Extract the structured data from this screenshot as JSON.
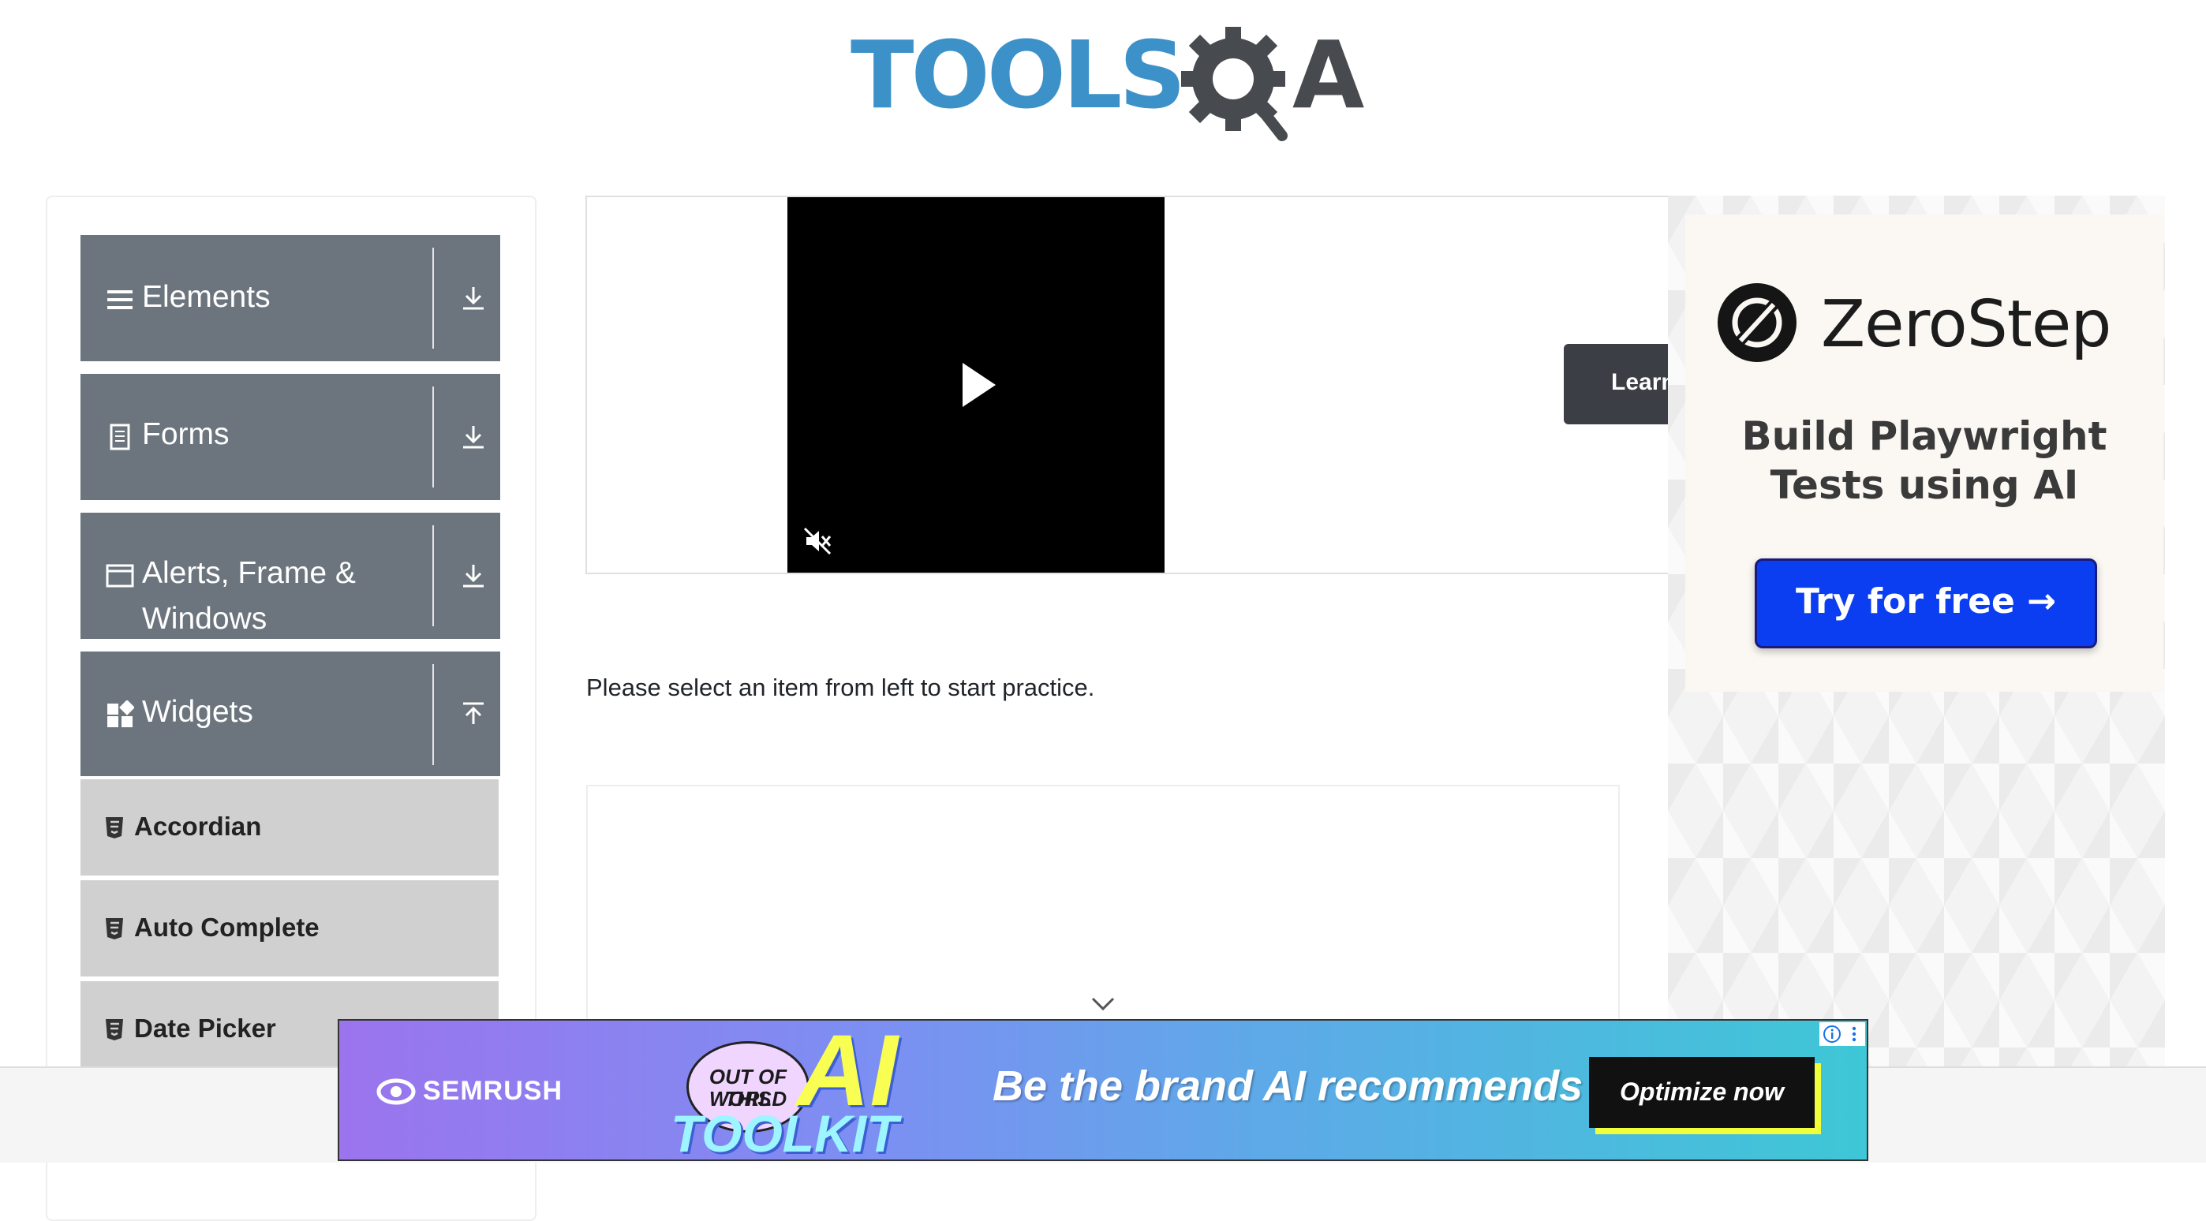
{
  "header": {
    "logo_text": "TOOLS",
    "logo_suffix": "A"
  },
  "sidebar": {
    "groups": [
      {
        "label": "Elements",
        "icon": "list-icon",
        "arrow": "download-arrow-icon"
      },
      {
        "label": "Forms",
        "icon": "document-icon",
        "arrow": "download-arrow-icon"
      },
      {
        "label_line1": "Alerts, Frame &",
        "label_line2": "Windows",
        "icon": "window-icon",
        "arrow": "download-arrow-icon"
      },
      {
        "label": "Widgets",
        "icon": "widgets-icon",
        "arrow": "upload-arrow-icon"
      }
    ],
    "items": [
      {
        "label": "Accordian",
        "icon": "html5-icon"
      },
      {
        "label": "Auto Complete",
        "icon": "html5-icon"
      },
      {
        "label": "Date Picker",
        "icon": "html5-icon"
      }
    ]
  },
  "video_ad": {
    "learn_label": "Learn"
  },
  "main": {
    "practice_text": "Please select an item from left to start practice."
  },
  "right_ad": {
    "brand": "ZeroStep",
    "tagline_line1": "Build Playwright",
    "tagline_line2": "Tests using AI",
    "cta": "Try for free →",
    "colors": {
      "cta_bg": "#0a3ef0",
      "card_bg": "#fbf8f3"
    }
  },
  "bottom_ad": {
    "brand": "SEMRUSH",
    "badge_line1": "OUT OF THIS",
    "badge_line2": "WORLD",
    "ai_text": "AI",
    "toolkit_text": "TOOLKIT",
    "headline": "Be the brand AI recommends",
    "cta": "Optimize now",
    "colors": {
      "cta_shadow": "#f1ff3a",
      "ai_color": "#f8ff52"
    }
  },
  "colors": {
    "sidebar_group_bg": "#6c757d",
    "sidebar_item_bg": "#d0d0d0",
    "logo_blue": "#3d91c9",
    "logo_dark": "#474a4e"
  }
}
